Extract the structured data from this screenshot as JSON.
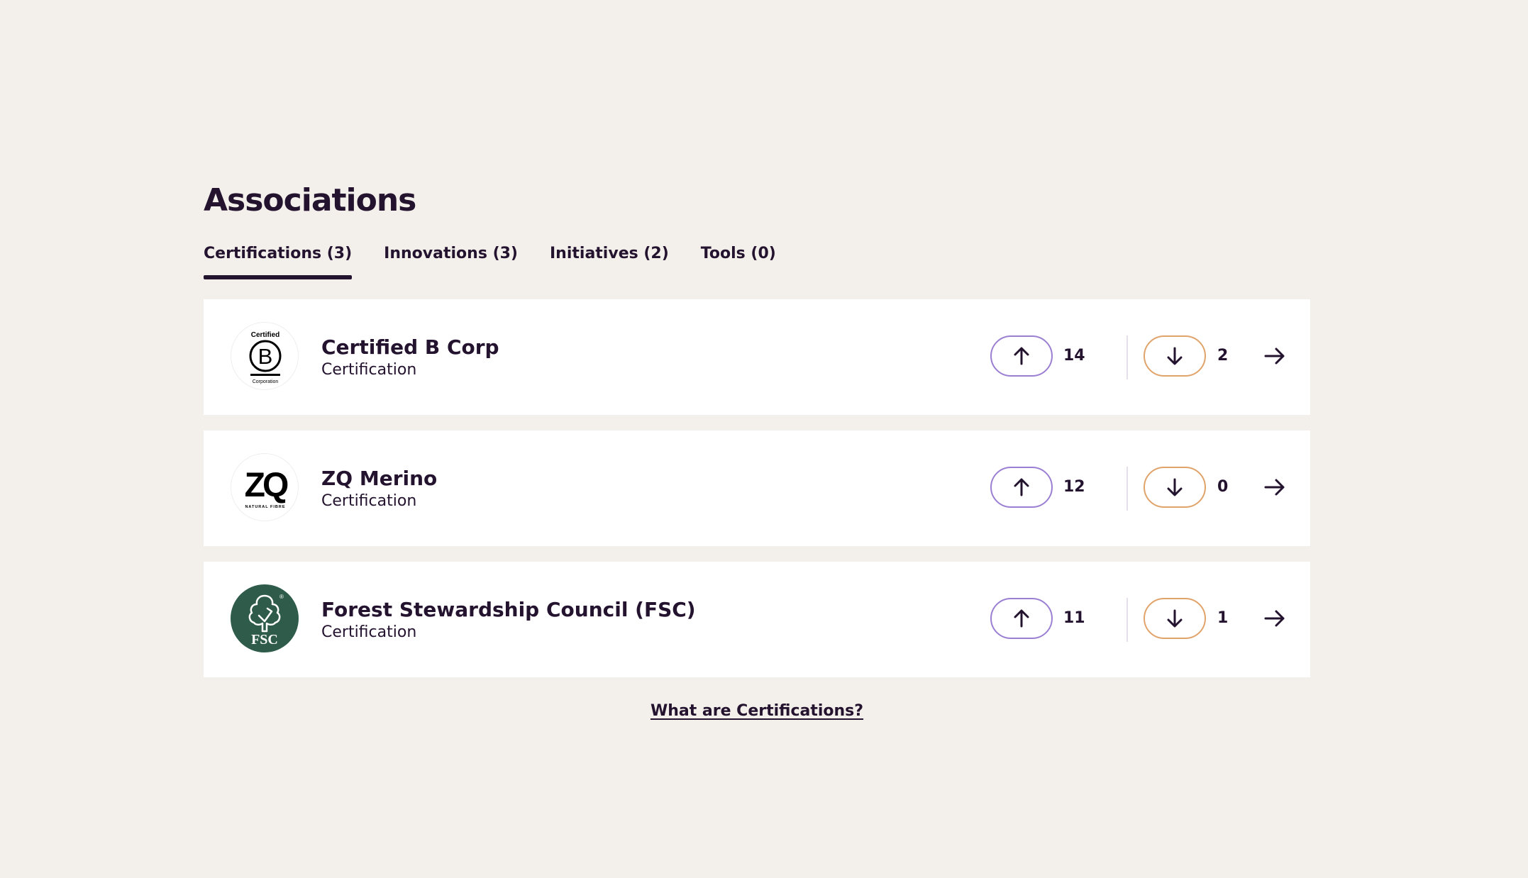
{
  "section": {
    "heading": "Associations"
  },
  "tabs": [
    {
      "label": "Certifications (3)",
      "active": true
    },
    {
      "label": "Innovations (3)",
      "active": false
    },
    {
      "label": "Initiatives (2)",
      "active": false
    },
    {
      "label": "Tools (0)",
      "active": false
    }
  ],
  "items": [
    {
      "name": "Certified B Corp",
      "type": "Certification",
      "up_count": "14",
      "down_count": "2",
      "logo": {
        "icon": "b-corp-logo",
        "text_top": "Certified",
        "letter": "B",
        "text_bottom": "Corporation"
      }
    },
    {
      "name": "ZQ Merino",
      "type": "Certification",
      "up_count": "12",
      "down_count": "0",
      "logo": {
        "icon": "zq-logo",
        "letters": "ZQ",
        "text_bottom": "NATURAL FIBRE"
      }
    },
    {
      "name": "Forest Stewardship Council (FSC)",
      "type": "Certification",
      "up_count": "11",
      "down_count": "1",
      "logo": {
        "icon": "fsc-tree-logo",
        "letters": "FSC",
        "mark": "®"
      }
    }
  ],
  "footer": {
    "link_text": "What are Certifications?"
  },
  "colors": {
    "background": "#f3f0eb",
    "text": "#24132f",
    "upvote_border": "#9b7fd2",
    "downvote_border": "#e0a36a",
    "fsc_green": "#2f5c4a"
  }
}
